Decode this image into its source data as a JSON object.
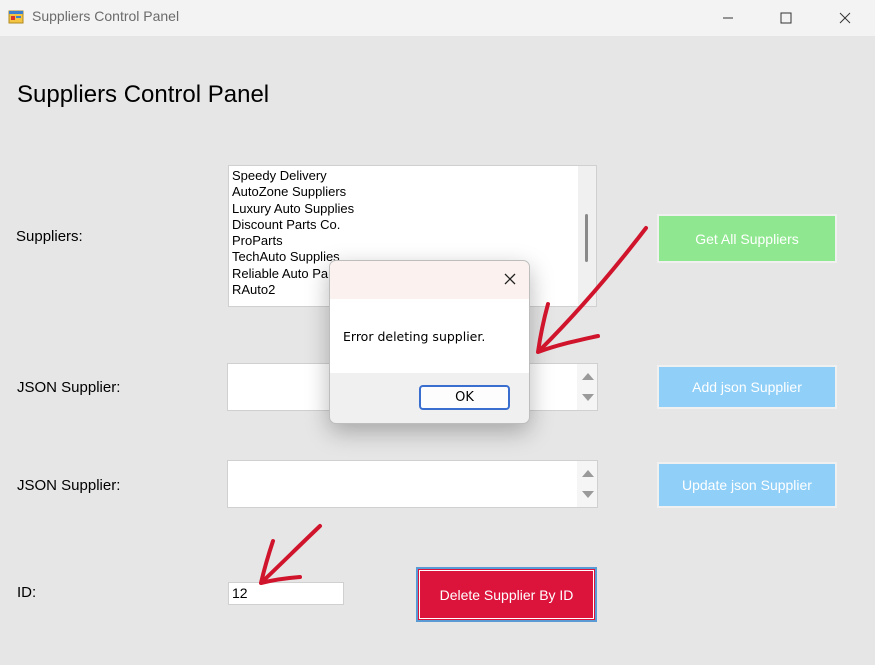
{
  "window": {
    "title": "Suppliers Control Panel",
    "app_icon": "windows-form-icon",
    "controls": [
      "minimize-icon",
      "maximize-icon",
      "close-icon"
    ]
  },
  "main": {
    "heading": "Suppliers Control Panel",
    "suppliers_label": "Suppliers:",
    "suppliers_list": [
      "Speedy Delivery",
      "AutoZone Suppliers",
      "Luxury Auto Supplies",
      "Discount Parts Co.",
      "ProParts",
      "TechAuto Supplies",
      "Reliable Auto Parts",
      "RAuto2"
    ],
    "get_all_button": "Get All Suppliers",
    "json_add_label": "JSON Supplier:",
    "json_add_value": "",
    "add_button": "Add json Supplier",
    "json_update_label": "JSON Supplier:",
    "json_update_value": "",
    "update_button": "Update json Supplier",
    "id_label": "ID:",
    "id_value": "12",
    "delete_button": "Delete Supplier By ID"
  },
  "dialog": {
    "message": "Error deleting supplier.",
    "ok_button": "OK"
  },
  "colors": {
    "green_button": "#8fe88f",
    "blue_button": "#8fcff8",
    "red_button": "#dc143c",
    "annotation_arrow": "#d0142c"
  }
}
